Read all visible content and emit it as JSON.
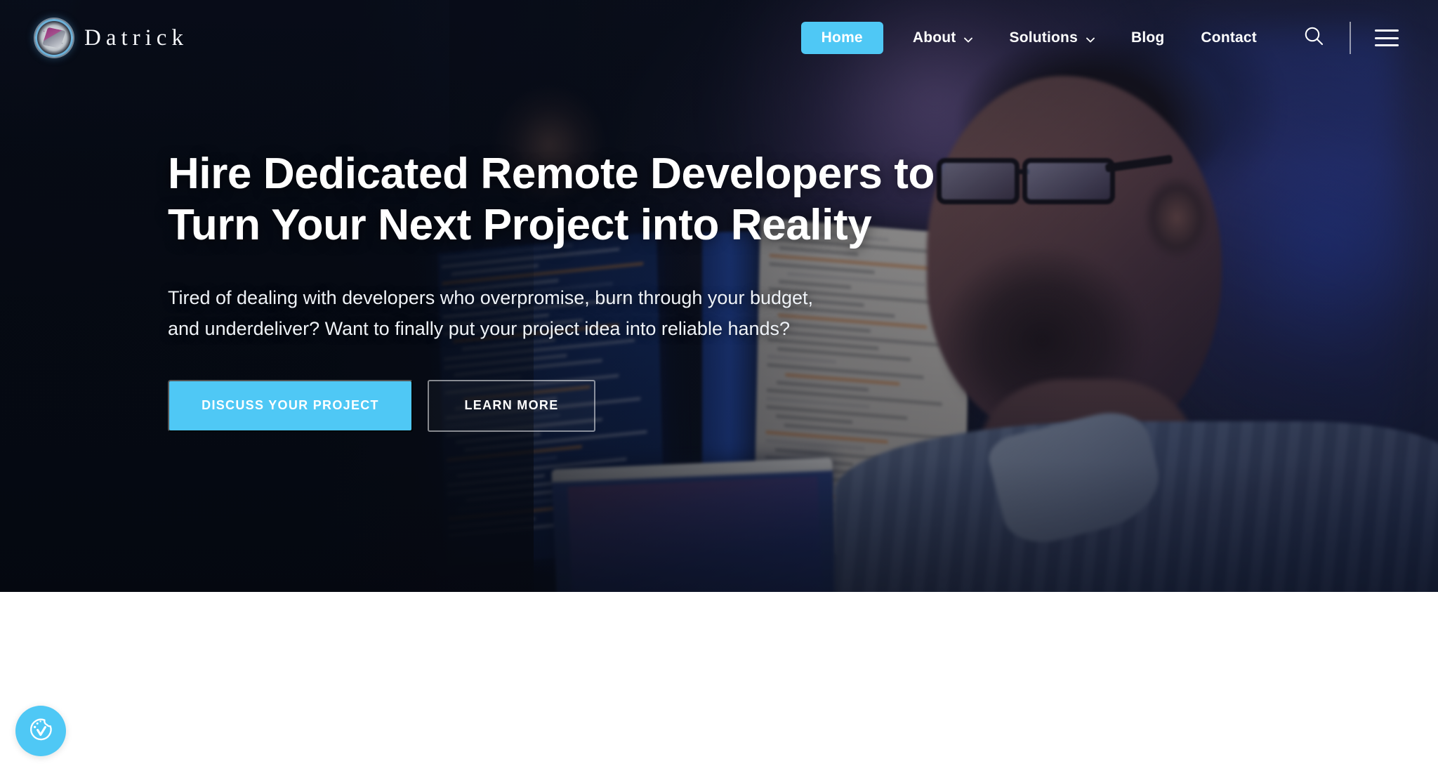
{
  "brand": {
    "name": "Datrick",
    "logo_icon": "datrick-circular-cube-logo"
  },
  "nav": {
    "items": [
      {
        "label": "Home",
        "active": true,
        "has_dropdown": false
      },
      {
        "label": "About",
        "active": false,
        "has_dropdown": true
      },
      {
        "label": "Solutions",
        "active": false,
        "has_dropdown": true
      },
      {
        "label": "Blog",
        "active": false,
        "has_dropdown": false
      },
      {
        "label": "Contact",
        "active": false,
        "has_dropdown": false
      }
    ],
    "search_icon": "search-icon",
    "menu_icon": "hamburger-menu-icon"
  },
  "hero": {
    "headline_line1": "Hire Dedicated Remote Developers to",
    "headline_line2": "Turn Your Next Project into Reality",
    "subhead_line1": "Tired of dealing with developers who overpromise, burn through your budget,",
    "subhead_line2": "and underdeliver? Want to finally put your project idea into reliable hands?",
    "primary_cta": "DISCUSS YOUR PROJECT",
    "secondary_cta": "LEARN MORE"
  },
  "cookie_widget": {
    "icon": "cookie-consent-icon"
  },
  "colors": {
    "accent_cyan": "#4fc8f5",
    "hero_dark": "#070d18",
    "text_white": "#ffffff",
    "page_background": "#ffffff"
  }
}
